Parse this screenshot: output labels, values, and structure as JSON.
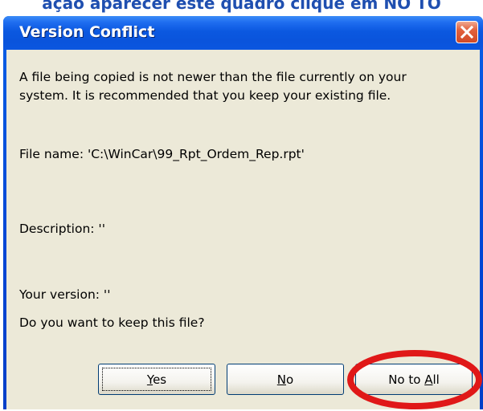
{
  "caption": {
    "text": "ação aparecer este quadro clique em NO TO"
  },
  "dialog": {
    "title": "Version Conflict",
    "message_line1": "A file being copied is not newer than the file currently on your",
    "message_line2": "system. It is recommended that you keep your existing file.",
    "file_name": "File name:   'C:\\WinCar\\99_Rpt_Ordem_Rep.rpt'",
    "description": "Description:  ''",
    "your_version": "Your version:  ''",
    "question": "Do you want to keep this file?"
  },
  "buttons": {
    "yes": {
      "accesskey": "Y",
      "rest": "es"
    },
    "no": {
      "accesskey": "N",
      "rest": "o"
    },
    "no_to_all": {
      "prefix": "No to ",
      "accesskey": "A",
      "rest": "ll"
    }
  },
  "colors": {
    "titlebar": "#0a54dc",
    "client": "#ece9d8",
    "annotation_ring": "#e01818",
    "caption_text": "#1f4fb0"
  },
  "icons": {
    "close": "close-icon"
  }
}
